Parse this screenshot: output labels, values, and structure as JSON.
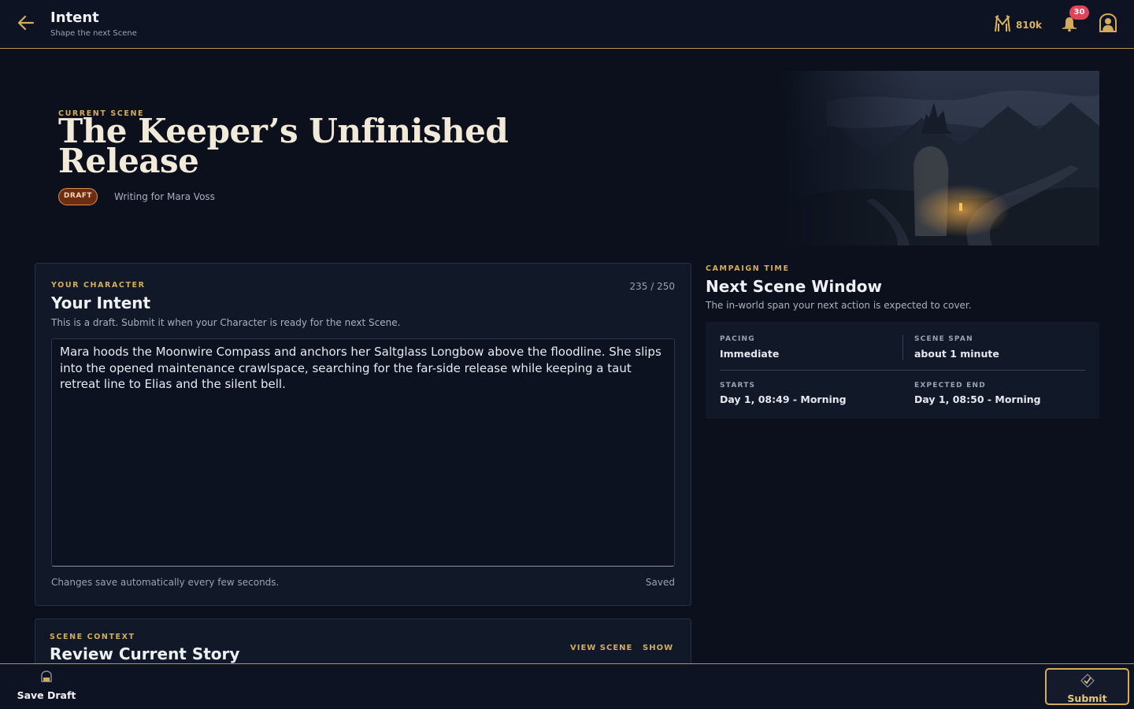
{
  "header": {
    "title": "Intent",
    "subtitle": "Shape the next Scene",
    "currency_value": "810k",
    "notification_count": "30"
  },
  "hero": {
    "eyebrow": "CURRENT SCENE",
    "title": "The Keeper’s Unfinished Release",
    "status_badge": "DRAFT",
    "writing_for": "Writing for Mara Voss"
  },
  "intent_card": {
    "eyebrow": "YOUR CHARACTER",
    "title": "Your Intent",
    "char_count": "235 / 250",
    "description": "This is a draft. Submit it when your Character is ready for the next Scene.",
    "text": "Mara hoods the Moonwire Compass and anchors her Saltglass Longbow above the floodline. She slips into the opened maintenance crawlspace, searching for the far-side release while keeping a taut retreat line to Elias and the silent bell.",
    "autosave_note": "Changes save automatically every few seconds.",
    "save_status": "Saved"
  },
  "context_card": {
    "eyebrow": "SCENE CONTEXT",
    "title": "Review Current Story",
    "view_scene_label": "VIEW SCENE",
    "show_label": "SHOW"
  },
  "campaign_time": {
    "eyebrow": "CAMPAIGN TIME",
    "title": "Next Scene Window",
    "description": "The in-world span your next action is expected to cover.",
    "pacing_label": "PACING",
    "pacing_value": "Immediate",
    "span_label": "SCENE SPAN",
    "span_value": "about 1 minute",
    "starts_label": "STARTS",
    "starts_value": "Day 1, 08:49 - Morning",
    "end_label": "EXPECTED END",
    "end_value": "Day 1, 08:50 - Morning"
  },
  "bottom_bar": {
    "save_draft_label": "Save Draft",
    "submit_label": "Submit"
  },
  "colors": {
    "background": "#0b101c",
    "accent_gold": "#d3ad5b",
    "draft_badge": "#6e2d12",
    "notification_badge": "#e04458"
  },
  "icons": [
    "back-arrow-icon",
    "currency-icon",
    "bell-icon",
    "avatar-icon",
    "save-icon",
    "submit-check-icon"
  ]
}
